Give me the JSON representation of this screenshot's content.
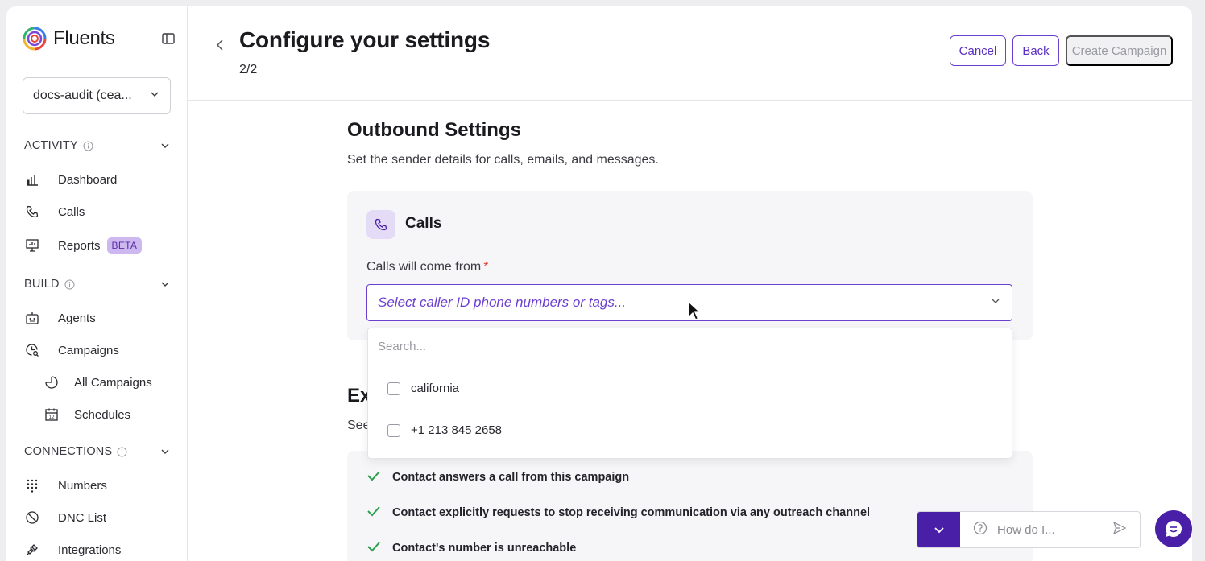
{
  "app": {
    "name": "Fluents",
    "workspace": "docs-audit (cea..."
  },
  "sidebar": {
    "sections": {
      "activity": "ACTIVITY",
      "build": "BUILD",
      "connections": "CONNECTIONS"
    },
    "items": {
      "dashboard": "Dashboard",
      "calls": "Calls",
      "reports": "Reports",
      "reports_badge": "BETA",
      "agents": "Agents",
      "campaigns": "Campaigns",
      "all_campaigns": "All Campaigns",
      "schedules": "Schedules",
      "numbers": "Numbers",
      "dnc_list": "DNC List",
      "integrations": "Integrations"
    }
  },
  "header": {
    "title": "Configure your settings",
    "step": "2/2",
    "cancel_label": "Cancel",
    "back_label": "Back",
    "create_label": "Create Campaign"
  },
  "outbound": {
    "title": "Outbound Settings",
    "description": "Set the sender details for calls, emails, and messages.",
    "calls_title": "Calls",
    "field_label": "Calls will come from",
    "required_mark": "*",
    "select_placeholder": "Select caller ID phone numbers or tags..."
  },
  "dropdown": {
    "search_placeholder": "Search...",
    "options": [
      "california",
      "+1 213 845 2658"
    ]
  },
  "exit": {
    "title_visible": "Ex",
    "desc_visible": "See",
    "conditions": [
      "Contact answers a call from this campaign",
      "Contact explicitly requests to stop receiving communication via any outreach channel",
      "Contact's number is unreachable"
    ]
  },
  "assistant": {
    "placeholder": "How do I..."
  },
  "colors": {
    "accent": "#6b3fd0",
    "accent_dark": "#4a1fa8",
    "beta_bg": "#cdb8f0",
    "check": "#2e9e4f"
  }
}
